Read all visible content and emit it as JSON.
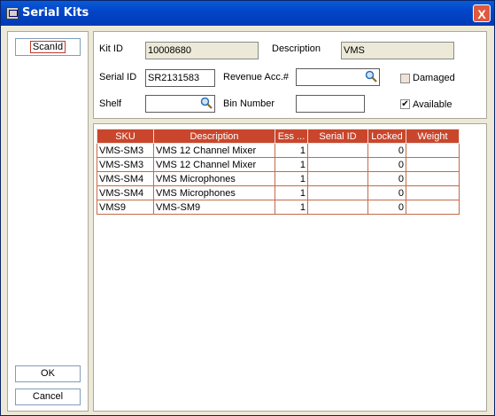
{
  "window": {
    "title": "Serial Kits",
    "close_label": "X"
  },
  "left": {
    "scan_label": "ScanId",
    "ok_label": "OK",
    "cancel_label": "Cancel"
  },
  "form": {
    "kit_id_label": "Kit ID",
    "kit_id_value": "10008680",
    "description_label": "Description",
    "description_value": "VMS",
    "serial_id_label": "Serial ID",
    "serial_id_value": "SR2131583",
    "revenue_label": "Revenue Acc.#",
    "revenue_value": "",
    "damaged_label": "Damaged",
    "damaged_checked": false,
    "shelf_label": "Shelf",
    "shelf_value": "",
    "bin_label": "Bin Number",
    "bin_value": "",
    "available_label": "Available",
    "available_checked": true
  },
  "grid": {
    "columns": [
      "SKU",
      "Description",
      "Ess ...",
      "Serial ID",
      "Locked",
      "Weight"
    ],
    "rows": [
      {
        "sku": "VMS-SM3",
        "description": "VMS 12  Channel Mixer",
        "ess": "1",
        "serial": "",
        "locked": "0",
        "weight": ""
      },
      {
        "sku": "VMS-SM3",
        "description": "VMS 12  Channel Mixer",
        "ess": "1",
        "serial": "",
        "locked": "0",
        "weight": ""
      },
      {
        "sku": "VMS-SM4",
        "description": "VMS Microphones",
        "ess": "1",
        "serial": "",
        "locked": "0",
        "weight": ""
      },
      {
        "sku": "VMS-SM4",
        "description": "VMS Microphones",
        "ess": "1",
        "serial": "",
        "locked": "0",
        "weight": ""
      },
      {
        "sku": "VMS9",
        "description": "VMS-SM9",
        "ess": "1",
        "serial": "",
        "locked": "0",
        "weight": ""
      }
    ]
  },
  "colors": {
    "titlebar": "#0246c8",
    "grid_header": "#c9462c",
    "close": "#e0583e"
  },
  "icons": {
    "lookup": "magnifier-icon",
    "app": "app-icon"
  }
}
